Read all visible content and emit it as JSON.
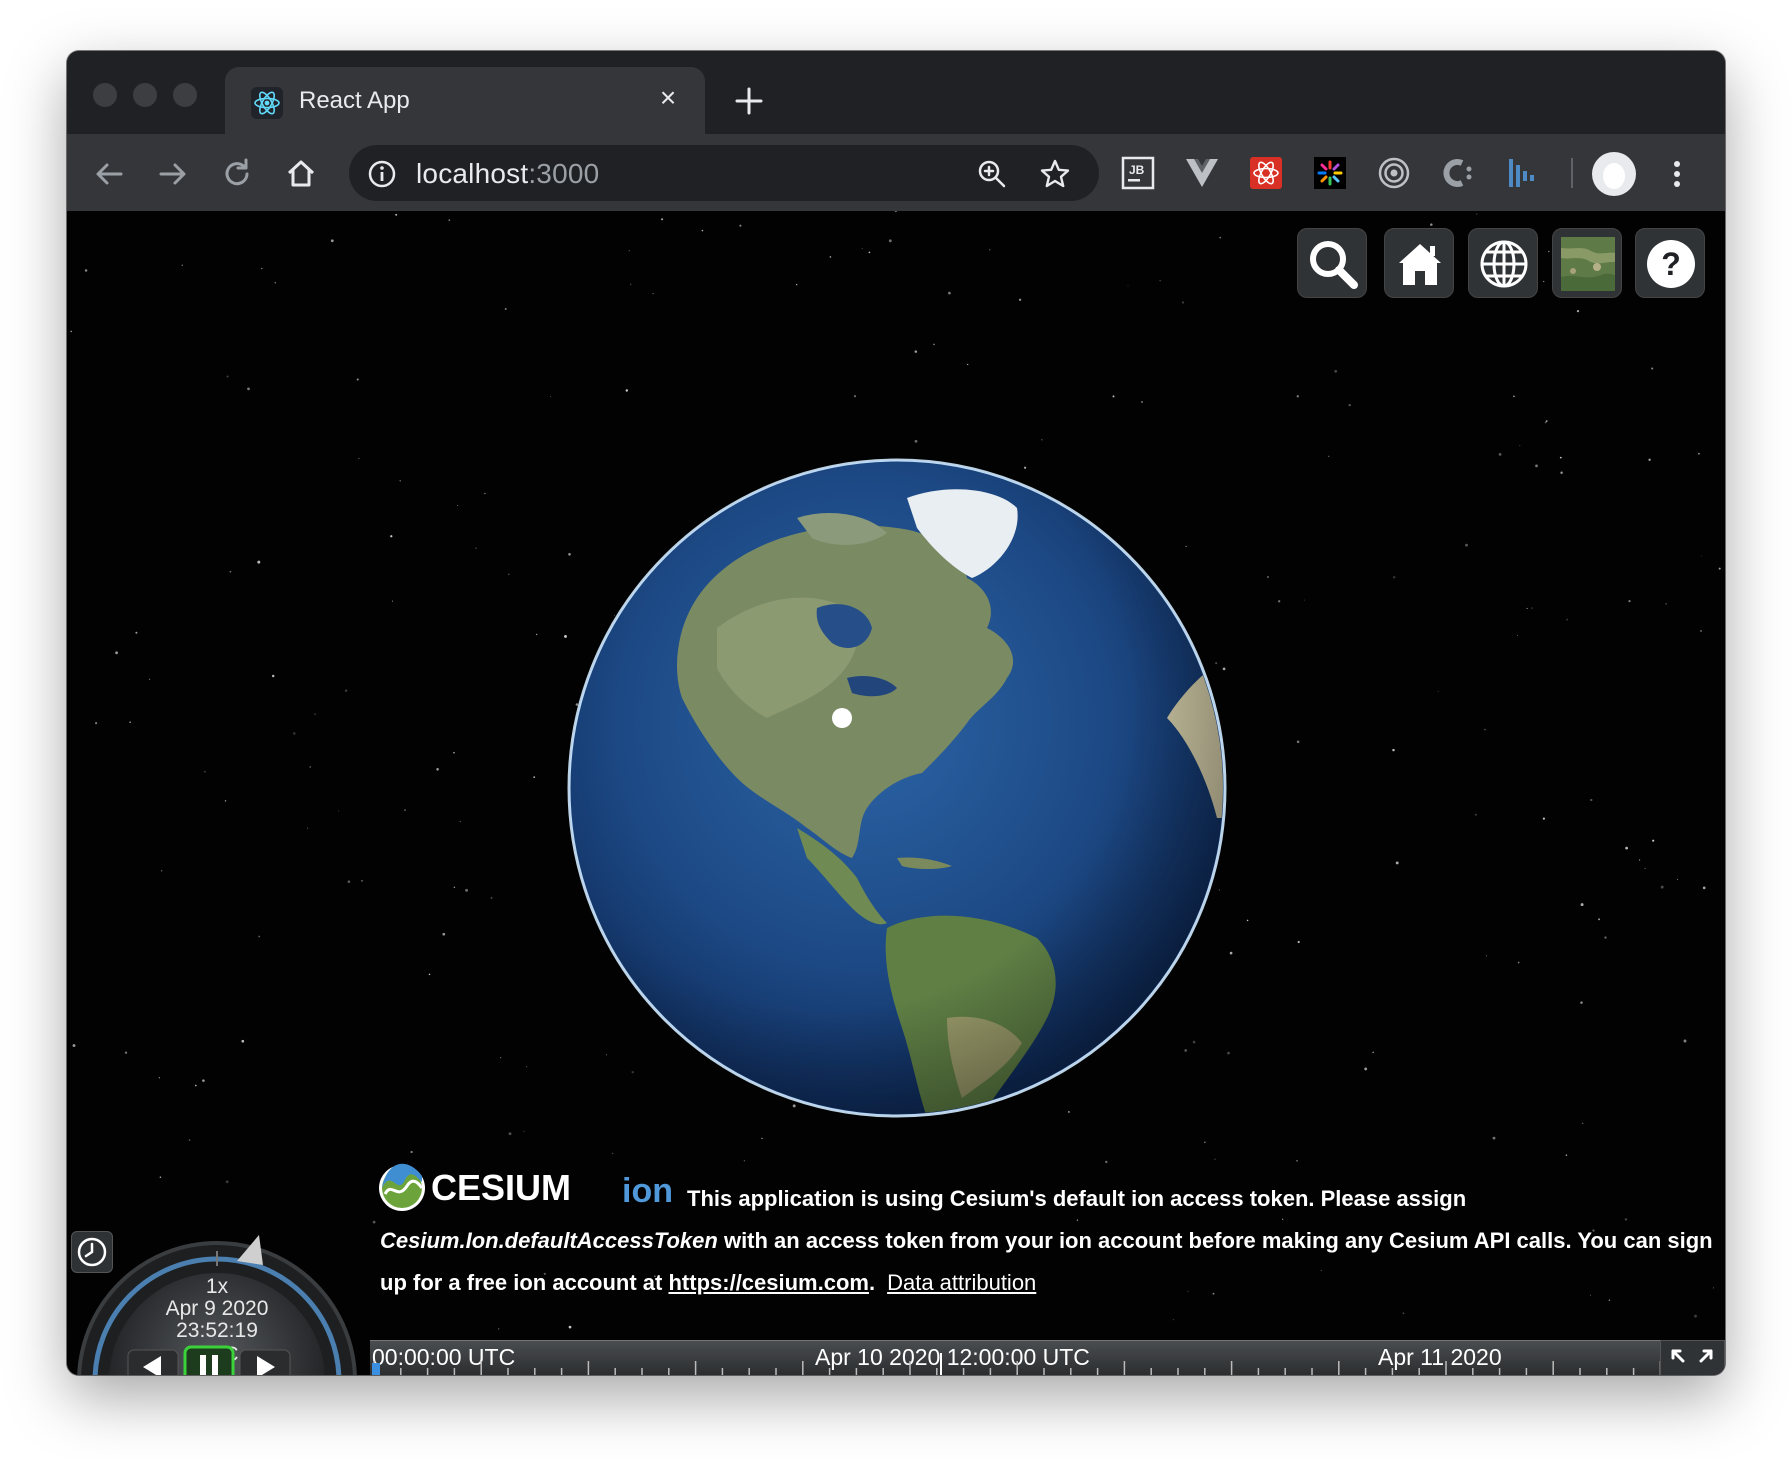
{
  "browser": {
    "tab_title": "React App",
    "tab_close": "×",
    "url_host": "localhost",
    "url_port": ":3000"
  },
  "viewer": {
    "toolbar_icons": [
      "search-icon",
      "home-icon",
      "globe-icon",
      "imagery-layer-icon",
      "help-icon"
    ],
    "help_label": "?"
  },
  "credits": {
    "logo_text_main": "CESIUM",
    "logo_text_sub": "ion",
    "line1": "This application is using Cesium's default ion access token. Please assign",
    "line2_token": "Cesium.Ion.defaultAccessToken",
    "line2_rest": " with an access token from your ion account before making any Cesium API calls. You can sign",
    "line3_prefix": "up for a free ion account at ",
    "line3_link": "https://cesium.com",
    "line3_suffix": ".",
    "data_attribution": "Data attribution"
  },
  "animation": {
    "speed": "1x",
    "date": "Apr 9 2020",
    "time": "23:52:19 UTC"
  },
  "timeline": {
    "label_start": "00:00:00 UTC",
    "label_mid": "Apr 10 2020 12:00:00 UTC",
    "label_end": "Apr 11 2020"
  },
  "colors": {
    "chrome_dark": "#202124",
    "chrome_toolbar": "#35363a",
    "play_active": "#3bd13b",
    "globe_ocean": "#1e4f8f",
    "atmosphere": "#bfe3ff"
  }
}
